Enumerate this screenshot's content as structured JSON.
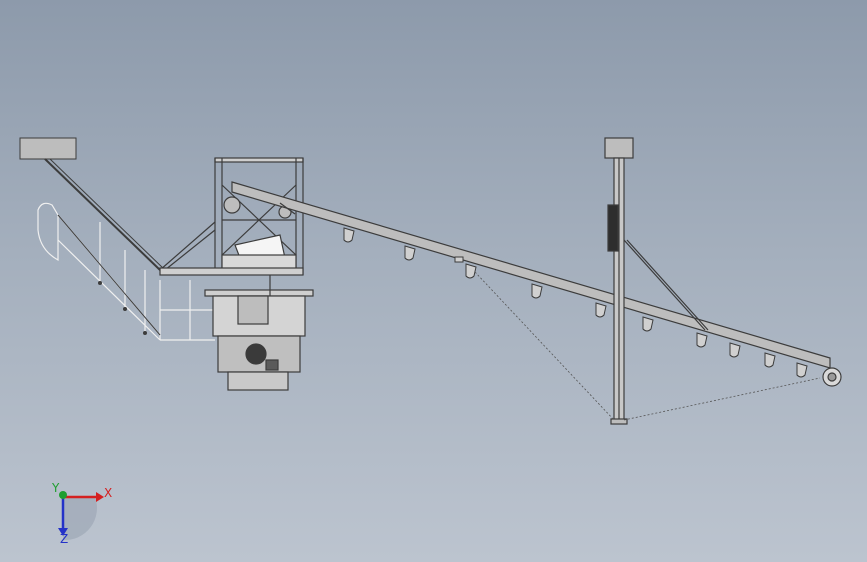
{
  "viewport": {
    "background_top": "#8d9aab",
    "background_bottom": "#bcc4cf"
  },
  "model": {
    "line_color": "#3c3c3c",
    "fill_color": "#c8c8c8",
    "dark_fill": "#5a5a5a"
  },
  "triad": {
    "x_label": "X",
    "y_label": "Y",
    "z_label": "Z",
    "x_color": "#d42020",
    "y_color": "#1f9e2f",
    "z_color": "#2432c8"
  }
}
